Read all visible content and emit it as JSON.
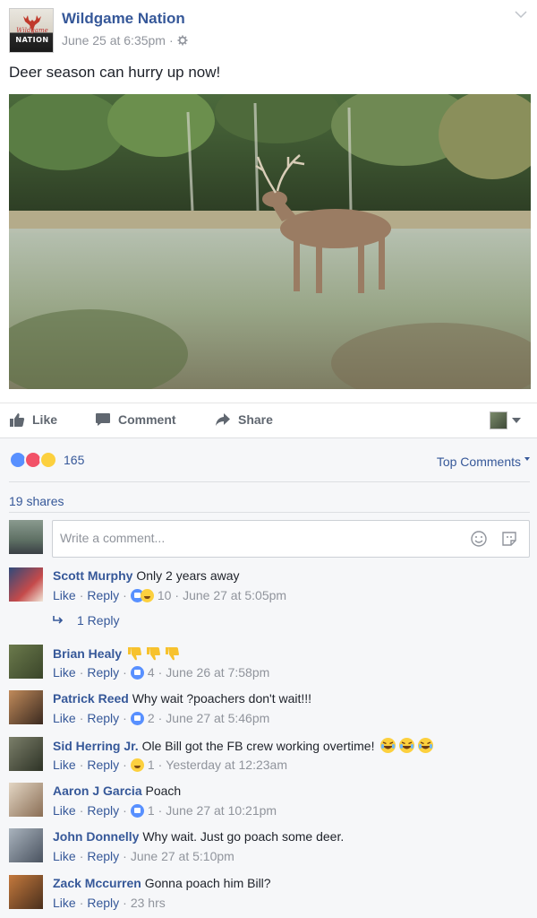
{
  "post": {
    "page_name": "Wildgame Nation",
    "logo_top": "Wildgame",
    "logo_bottom": "NATION",
    "timestamp": "June 25 at 6:35pm",
    "separator": "·",
    "text": "Deer season can hurry up now!"
  },
  "actions": {
    "like": "Like",
    "comment": "Comment",
    "share": "Share"
  },
  "reactions": {
    "count": "165",
    "top_comments": "Top Comments"
  },
  "shares": "19 shares",
  "composer": {
    "placeholder": "Write a comment..."
  },
  "comments": [
    {
      "author": "Scott Murphy",
      "text": "Only 2 years away",
      "like": "Like",
      "reply": "Reply",
      "reaction_count": "10",
      "time": "June 27 at 5:05pm"
    },
    {
      "author": "Brian Healy",
      "text": "",
      "like": "Like",
      "reply": "Reply",
      "reaction_count": "4",
      "time": "June 26 at 7:58pm"
    },
    {
      "author": "Patrick Reed",
      "text": "Why wait ?poachers don't wait!!!",
      "like": "Like",
      "reply": "Reply",
      "reaction_count": "2",
      "time": "June 27 at 5:46pm"
    },
    {
      "author": "Sid Herring Jr.",
      "text": "Ole Bill got the FB crew working overtime!",
      "like": "Like",
      "reply": "Reply",
      "reaction_count": "1",
      "time": "Yesterday at 12:23am"
    },
    {
      "author": "Aaron J Garcia",
      "text": "Poach",
      "like": "Like",
      "reply": "Reply",
      "reaction_count": "1",
      "time": "June 27 at 10:21pm"
    },
    {
      "author": "John Donnelly",
      "text": "Why wait. Just go poach some deer.",
      "like": "Like",
      "reply": "Reply",
      "time": "June 27 at 5:10pm"
    },
    {
      "author": "Zack Mccurren",
      "text": "Gonna poach him Bill?",
      "like": "Like",
      "reply": "Reply",
      "time": "23 hrs"
    }
  ],
  "replies_link": "1 Reply",
  "colors": {
    "link": "#365899",
    "meta": "#90949c",
    "like_blue": "#5890ff",
    "love_red": "#f25268",
    "wow_yellow": "#fcd03e"
  }
}
